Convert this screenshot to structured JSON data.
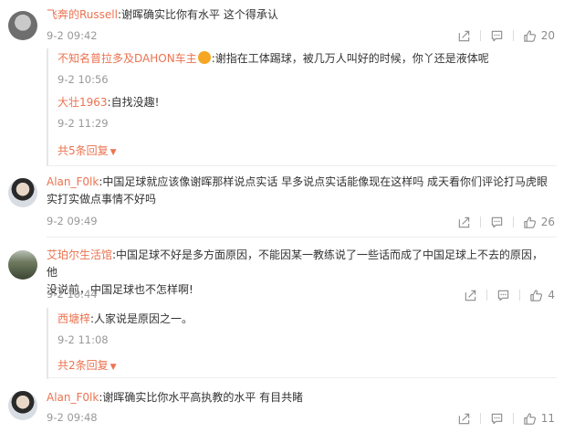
{
  "comments": [
    {
      "user": "飞奔的Russell",
      "text": ":谢晖确实比你有水平 这个得承认",
      "time": "9-2 09:42",
      "likes": "20",
      "replies": [
        {
          "user": "不知名普拉多及DAHON车主",
          "text": ":谢指在工体踢球，被几万人叫好的时候，你丫还是液体呢",
          "time": "9-2 10:56"
        },
        {
          "user": "大壮1963",
          "text": ":自找没趣!",
          "time": "9-2 11:29"
        }
      ],
      "more_label": "共5条回复"
    },
    {
      "user": "Alan_F0lk",
      "text": ":中国足球就应该像谢晖那样说点实话 早多说点实话能像现在这样吗 成天看你们评论打马虎眼",
      "text2": "实打实做点事情不好吗",
      "time": "9-2 09:49",
      "likes": "26"
    },
    {
      "user": "艾珀尔生活馆",
      "text": ":中国足球不好是多方面原因，不能因某一教练说了一些话而成了中国足球上不去的原因，他",
      "text2": "没说前，中国足球也不怎样啊!",
      "time": "9-2 10:44",
      "likes": "4",
      "replies": [
        {
          "user": "西塘梓",
          "text": ":人家说是原因之一。",
          "time": "9-2 11:08"
        }
      ],
      "more_label": "共2条回复"
    },
    {
      "user": "Alan_F0lk",
      "text": ":谢晖确实比你水平高执教的水平 有目共睹",
      "time": "9-2 09:48",
      "likes": "11"
    }
  ],
  "icons": {
    "share": "share-icon",
    "comment": "comment-icon",
    "like": "thumbs-up-icon",
    "more": "caret-down-icon"
  },
  "colors": {
    "username": "#eb7350",
    "time": "#999999",
    "icon": "#8b8b8b"
  }
}
